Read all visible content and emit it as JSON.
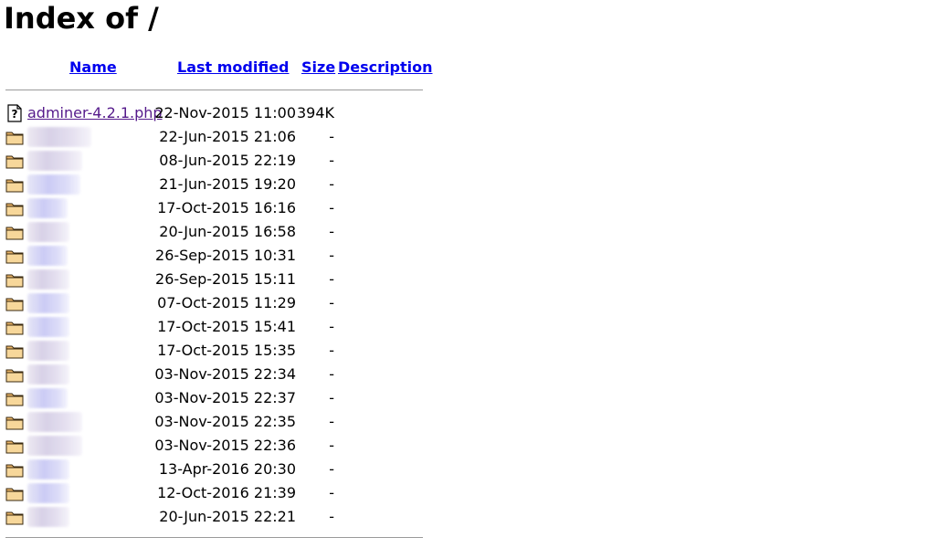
{
  "page": {
    "title": "Index of /"
  },
  "columns": {
    "name": "Name",
    "last_modified": "Last modified",
    "size": "Size",
    "description": "Description"
  },
  "entries": [
    {
      "type": "file",
      "name": "adminer-4.2.1.php",
      "modified": "22-Nov-2015 11:00",
      "size": "394K"
    },
    {
      "type": "folder",
      "modified": "22-Jun-2015 21:06",
      "size": "-"
    },
    {
      "type": "folder",
      "modified": "08-Jun-2015 22:19",
      "size": "-"
    },
    {
      "type": "folder",
      "modified": "21-Jun-2015 19:20",
      "size": "-"
    },
    {
      "type": "folder",
      "modified": "17-Oct-2015 16:16",
      "size": "-"
    },
    {
      "type": "folder",
      "modified": "20-Jun-2015 16:58",
      "size": "-"
    },
    {
      "type": "folder",
      "modified": "26-Sep-2015 10:31",
      "size": "-"
    },
    {
      "type": "folder",
      "modified": "26-Sep-2015 15:11",
      "size": "-"
    },
    {
      "type": "folder",
      "modified": "07-Oct-2015 11:29",
      "size": "-"
    },
    {
      "type": "folder",
      "modified": "17-Oct-2015 15:41",
      "size": "-"
    },
    {
      "type": "folder",
      "modified": "17-Oct-2015 15:35",
      "size": "-"
    },
    {
      "type": "folder",
      "modified": "03-Nov-2015 22:34",
      "size": "-"
    },
    {
      "type": "folder",
      "modified": "03-Nov-2015 22:37",
      "size": "-"
    },
    {
      "type": "folder",
      "modified": "03-Nov-2015 22:35",
      "size": "-"
    },
    {
      "type": "folder",
      "modified": "03-Nov-2015 22:36",
      "size": "-"
    },
    {
      "type": "folder",
      "modified": "13-Apr-2016 20:30",
      "size": "-"
    },
    {
      "type": "folder",
      "modified": "12-Oct-2016 21:39",
      "size": "-"
    },
    {
      "type": "folder",
      "modified": "20-Jun-2015 22:21",
      "size": "-"
    }
  ],
  "icons": {
    "file": "unknown-file-icon",
    "folder": "folder-icon"
  },
  "colors": {
    "link": "#0000ee",
    "visited_link": "#551a8b",
    "rule": "#9a9a9a"
  }
}
